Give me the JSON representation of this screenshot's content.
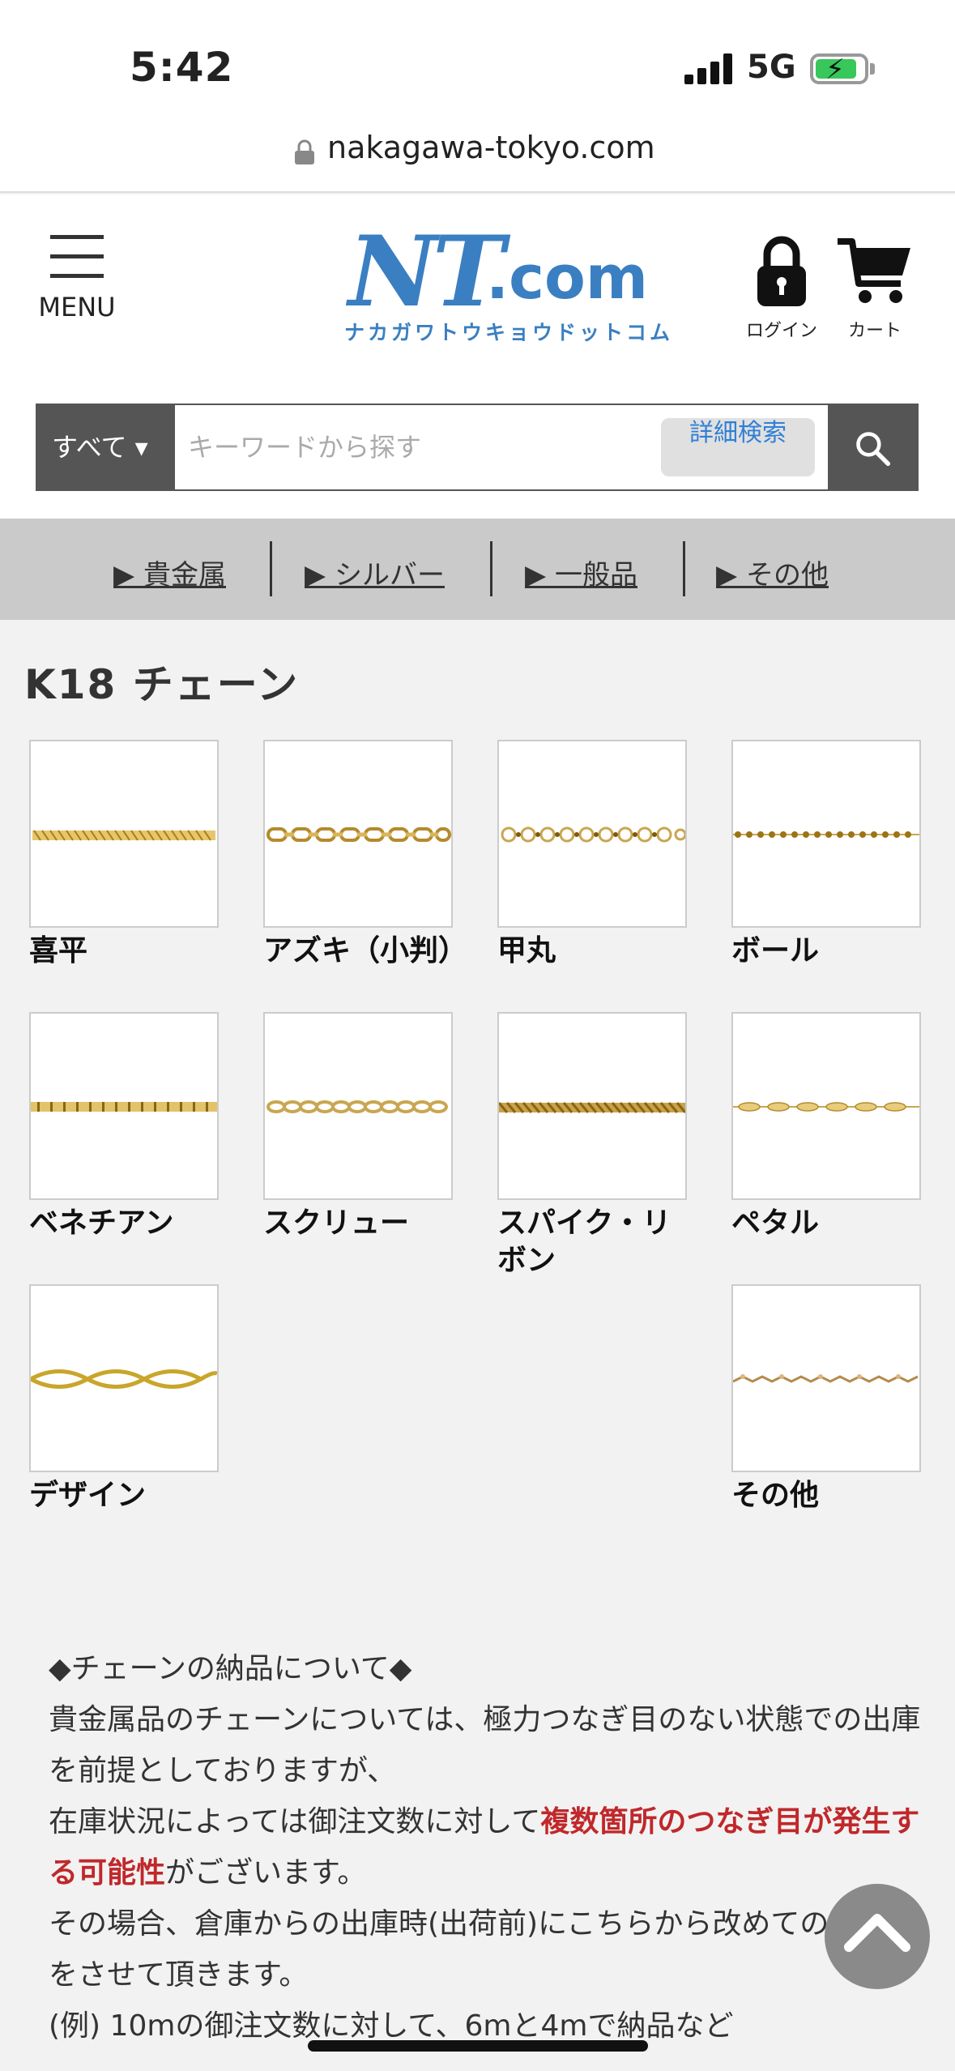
{
  "status_bar": {
    "time": "5:42",
    "network": "5G",
    "battery_color": "#37c75a"
  },
  "browser": {
    "url": "nakagawa-tokyo.com"
  },
  "header": {
    "menu_label": "MENU",
    "logo_mark": "NT",
    "logo_domain": ".com",
    "logo_kana": "ナカガワトウキョウドットコム",
    "login_label": "ログイン",
    "cart_label": "カート",
    "brand_color": "#3a7fc1"
  },
  "search": {
    "category": "すべて ▾",
    "placeholder": "キーワードから探す",
    "advanced_label": "詳細検索"
  },
  "category_nav": [
    {
      "label": "▶ 貴金属"
    },
    {
      "label": "▶ シルバー"
    },
    {
      "label": "▶ 一般品"
    },
    {
      "label": "▶ その他"
    }
  ],
  "page": {
    "title": "K18 チェーン",
    "products": [
      {
        "name": "喜平",
        "icon": "curb-chain-icon"
      },
      {
        "name": "アズキ（小判）",
        "icon": "cable-chain-icon"
      },
      {
        "name": "甲丸",
        "icon": "rolo-chain-icon"
      },
      {
        "name": "ボール",
        "icon": "ball-chain-icon"
      },
      {
        "name": "ベネチアン",
        "icon": "venetian-chain-icon"
      },
      {
        "name": "スクリュー",
        "icon": "screw-chain-icon"
      },
      {
        "name": "スパイク・リボン",
        "icon": "spike-chain-icon"
      },
      {
        "name": "ペタル",
        "icon": "petal-chain-icon"
      },
      {
        "name": "デザイン",
        "icon": "design-chain-icon"
      },
      {
        "name": "その他",
        "icon": "other-chain-icon"
      }
    ]
  },
  "notice": {
    "heading": "◆チェーンの納品について◆",
    "line1": "貴金属品のチェーンについては、極力つなぎ目のない状態での出庫を前提としておりますが、",
    "line2_pre": "在庫状況によっては御注文数に対して",
    "line2_red": "複数箇所のつなぎ目が発生する可能性",
    "line2_post": "がございます。",
    "line3": "その場合、倉庫からの出庫時(出荷前)にこちらから改めてのご連絡をさせて頂きます。",
    "line4": "(例) 10mの御注文数に対して、6mと4mで納品など"
  }
}
